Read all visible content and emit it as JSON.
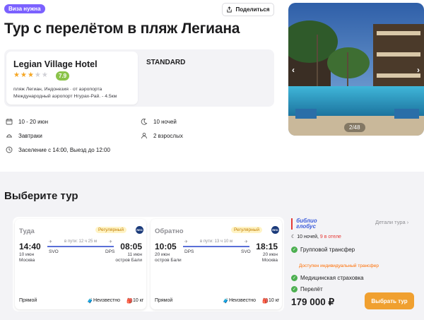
{
  "header": {
    "visa_badge": "Виза нужна",
    "share_label": "Поделиться",
    "title": "Тур с перелётом в пляж Легиана"
  },
  "hotel": {
    "name": "Legian Village Hotel",
    "stars_filled": 3,
    "stars_total": 5,
    "rating": "7.9",
    "location": "пляж Легиан, Индонезия · от аэропорта",
    "airport": "Международный аэропорт Нгурах-Рай. - 4.5км",
    "room_type": "STANDARD"
  },
  "info": {
    "dates": "10 - 20 июн",
    "nights": "10 ночей",
    "meals": "Завтраки",
    "guests": "2 взрослых",
    "checkin": "Заселение с 14:00, Выезд до 12:00"
  },
  "gallery": {
    "counter": "2/48",
    "prev": "‹",
    "next": "›"
  },
  "tours": {
    "section_title": "Выберите тур",
    "outbound": {
      "label": "Туда",
      "badge": "Регулярный",
      "airline": "RED",
      "dep_time": "14:40",
      "dep_date": "10 июн",
      "dep_city": "Москва",
      "dep_code": "SVO",
      "duration": "в пути: 12 ч 25 м",
      "arr_code": "DPS",
      "arr_time": "08:05",
      "arr_date": "11 июн",
      "arr_city": "остров Бали",
      "type": "Прямой",
      "baggage": "Неизвестно",
      "hand": "10 кг"
    },
    "return": {
      "label": "Обратно",
      "badge": "Регулярный",
      "airline": "RED",
      "dep_time": "10:05",
      "dep_date": "20 июн",
      "dep_city": "остров Бали",
      "dep_code": "DPS",
      "duration": "в пути: 13 ч 10 м",
      "arr_code": "SVO",
      "arr_time": "18:15",
      "arr_date": "20 июн",
      "arr_city": "Москва",
      "type": "Прямой",
      "baggage": "Неизвестно",
      "hand": "10 кг"
    },
    "offer": {
      "operator_line1": "библио",
      "operator_line2": "глобус",
      "details_link": "Детали тура",
      "nights": "10 ночей,",
      "nights_hotel": "9 в отеле",
      "transfer": "Групповой трансфер",
      "transfer_note": "Доступен индивидуальный трансфер",
      "insurance": "Медицинская страховка",
      "flight": "Перелёт",
      "price": "179 000 ₽",
      "select_label": "Выбрать тур"
    }
  },
  "colors": {
    "visa_badge": "#7b61ff",
    "rating": "#8bc34a",
    "accent_button": "#f0a030",
    "route": "#5a6fd8",
    "warning": "#ff6d00"
  }
}
